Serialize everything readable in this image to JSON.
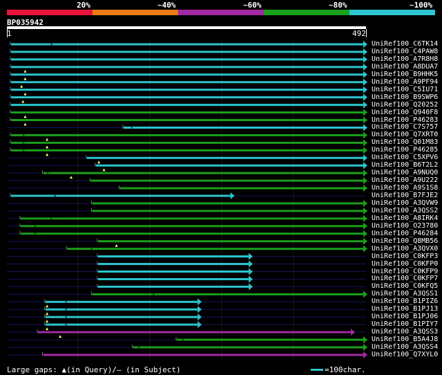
{
  "legend": {
    "labels": [
      "20%",
      "~40%",
      "~60%",
      "~80%",
      "~100%"
    ],
    "colors": [
      "#e8143c",
      "#ea7a16",
      "#a22aa2",
      "#1aa01a",
      "#2bc6d0"
    ]
  },
  "query": {
    "id": "BP035942",
    "start": "1",
    "end": "492",
    "length": 492
  },
  "footer": {
    "gaps_text": "Large gaps: ▲(in Query)/– (in Subject)",
    "scale_text": "=100char."
  },
  "colors": {
    "cyan": "#2bc6d0",
    "green": "#1aa01a",
    "magenta": "#a22aa2",
    "background": "#000000",
    "faint": "#14145a"
  },
  "hits": [
    {
      "id": "UniRef100_C6TK14",
      "color": "cyan",
      "qs": 1,
      "qe": 492,
      "gaps_q": [],
      "gaps_s": [
        60
      ]
    },
    {
      "id": "UniRef100_C4PAW8",
      "color": "cyan",
      "qs": 1,
      "qe": 492,
      "gaps_q": [],
      "gaps_s": []
    },
    {
      "id": "UniRef100_A7R8H8",
      "color": "cyan",
      "qs": 1,
      "qe": 492,
      "gaps_q": [],
      "gaps_s": []
    },
    {
      "id": "UniRef100_A8DUA7",
      "color": "cyan",
      "qs": 1,
      "qe": 492,
      "gaps_q": [
        25
      ],
      "gaps_s": []
    },
    {
      "id": "UniRef100_B9HHK5",
      "color": "cyan",
      "qs": 1,
      "qe": 492,
      "gaps_q": [
        25
      ],
      "gaps_s": []
    },
    {
      "id": "UniRef100_A9PF94",
      "color": "cyan",
      "qs": 1,
      "qe": 492,
      "gaps_q": [
        20
      ],
      "gaps_s": []
    },
    {
      "id": "UniRef100_C5IU71",
      "color": "cyan",
      "qs": 1,
      "qe": 492,
      "gaps_q": [
        25
      ],
      "gaps_s": []
    },
    {
      "id": "UniRef100_B9SWP6",
      "color": "cyan",
      "qs": 1,
      "qe": 492,
      "gaps_q": [
        22
      ],
      "gaps_s": []
    },
    {
      "id": "UniRef100_Q20252",
      "color": "cyan",
      "qs": 1,
      "qe": 492,
      "gaps_q": [],
      "gaps_s": []
    },
    {
      "id": "UniRef100_Q940F8",
      "color": "green",
      "qs": 1,
      "qe": 492,
      "gaps_q": [
        25
      ],
      "gaps_s": []
    },
    {
      "id": "UniRef100_P46283",
      "color": "green",
      "qs": 1,
      "qe": 492,
      "gaps_q": [
        25
      ],
      "gaps_s": []
    },
    {
      "id": "UniRef100_C7S757",
      "color": "cyan",
      "qs": 155,
      "qe": 492,
      "gaps_q": [],
      "gaps_s": [
        170
      ]
    },
    {
      "id": "UniRef100_Q7XRT0",
      "color": "green",
      "qs": 1,
      "qe": 492,
      "gaps_q": [
        55
      ],
      "gaps_s": [
        22
      ]
    },
    {
      "id": "UniRef100_Q01M83",
      "color": "green",
      "qs": 1,
      "qe": 492,
      "gaps_q": [
        55
      ],
      "gaps_s": [
        22
      ]
    },
    {
      "id": "UniRef100_P46285",
      "color": "green",
      "qs": 1,
      "qe": 492,
      "gaps_q": [
        55
      ],
      "gaps_s": [
        22
      ]
    },
    {
      "id": "UniRef100_C5XPV6",
      "color": "cyan",
      "qs": 105,
      "qe": 492,
      "gaps_q": [
        126
      ],
      "gaps_s": []
    },
    {
      "id": "UniRef100_B6T2L2",
      "color": "cyan",
      "qs": 117,
      "qe": 492,
      "gaps_q": [
        133
      ],
      "gaps_s": []
    },
    {
      "id": "UniRef100_A9NUQ0",
      "color": "green",
      "qs": 45,
      "qe": 492,
      "gaps_q": [
        88
      ],
      "gaps_s": [
        55
      ]
    },
    {
      "id": "UniRef100_A9U222",
      "color": "green",
      "qs": 110,
      "qe": 492,
      "gaps_q": [],
      "gaps_s": []
    },
    {
      "id": "UniRef100_A9S1S8",
      "color": "green",
      "qs": 150,
      "qe": 492,
      "gaps_q": [],
      "gaps_s": []
    },
    {
      "id": "UniRef100_B7FJE2",
      "color": "cyan",
      "qs": 1,
      "qe": 310,
      "gaps_q": [],
      "gaps_s": [
        65
      ]
    },
    {
      "id": "UniRef100_A3QVW9",
      "color": "green",
      "qs": 112,
      "qe": 492,
      "gaps_q": [],
      "gaps_s": []
    },
    {
      "id": "UniRef100_A3QSS2",
      "color": "green",
      "qs": 112,
      "qe": 492,
      "gaps_q": [],
      "gaps_s": []
    },
    {
      "id": "UniRef100_A8IRK4",
      "color": "green",
      "qs": 14,
      "qe": 492,
      "gaps_q": [],
      "gaps_s": [
        60
      ]
    },
    {
      "id": "UniRef100_O23780",
      "color": "green",
      "qs": 14,
      "qe": 492,
      "gaps_q": [],
      "gaps_s": [
        38
      ]
    },
    {
      "id": "UniRef100_P46284",
      "color": "green",
      "qs": 14,
      "qe": 492,
      "gaps_q": [],
      "gaps_s": [
        38
      ]
    },
    {
      "id": "UniRef100_Q8MB56",
      "color": "green",
      "qs": 120,
      "qe": 492,
      "gaps_q": [
        150
      ],
      "gaps_s": []
    },
    {
      "id": "UniRef100_A3QVX0",
      "color": "green",
      "qs": 78,
      "qe": 492,
      "gaps_q": [],
      "gaps_s": [
        115
      ]
    },
    {
      "id": "UniRef100_C0KFP3",
      "color": "cyan",
      "qs": 120,
      "qe": 335,
      "gaps_q": [],
      "gaps_s": []
    },
    {
      "id": "UniRef100_C0KFP0",
      "color": "cyan",
      "qs": 120,
      "qe": 335,
      "gaps_q": [],
      "gaps_s": []
    },
    {
      "id": "UniRef100_C0KFP9",
      "color": "cyan",
      "qs": 120,
      "qe": 335,
      "gaps_q": [],
      "gaps_s": []
    },
    {
      "id": "UniRef100_C0KFP7",
      "color": "cyan",
      "qs": 120,
      "qe": 335,
      "gaps_q": [],
      "gaps_s": []
    },
    {
      "id": "UniRef100_C0KFQ5",
      "color": "cyan",
      "qs": 120,
      "qe": 335,
      "gaps_q": [],
      "gaps_s": []
    },
    {
      "id": "UniRef100_A3QSS1",
      "color": "green",
      "qs": 112,
      "qe": 492,
      "gaps_q": [],
      "gaps_s": [
        200
      ]
    },
    {
      "id": "UniRef100_B1PIZ6",
      "color": "cyan",
      "qs": 48,
      "qe": 265,
      "gaps_q": [
        55
      ],
      "gaps_s": [
        80
      ]
    },
    {
      "id": "UniRef100_B1PJ13",
      "color": "cyan",
      "qs": 48,
      "qe": 265,
      "gaps_q": [
        55
      ],
      "gaps_s": [
        80
      ]
    },
    {
      "id": "UniRef100_B1PJ06",
      "color": "cyan",
      "qs": 48,
      "qe": 265,
      "gaps_q": [
        55
      ],
      "gaps_s": [
        80
      ]
    },
    {
      "id": "UniRef100_B1PIY7",
      "color": "cyan",
      "qs": 48,
      "qe": 265,
      "gaps_q": [
        55
      ],
      "gaps_s": [
        80
      ]
    },
    {
      "id": "UniRef100_A3QSS3",
      "color": "magenta",
      "qs": 38,
      "qe": 475,
      "gaps_q": [
        73
      ],
      "gaps_s": []
    },
    {
      "id": "UniRef100_B5A4J8",
      "color": "green",
      "qs": 228,
      "qe": 492,
      "gaps_q": [],
      "gaps_s": [
        240
      ]
    },
    {
      "id": "UniRef100_A3QSS4",
      "color": "green",
      "qs": 168,
      "qe": 492,
      "gaps_q": [],
      "gaps_s": [
        180
      ]
    },
    {
      "id": "UniRef100_Q7XYL0",
      "color": "magenta",
      "qs": 45,
      "qe": 492,
      "gaps_q": [],
      "gaps_s": []
    }
  ]
}
